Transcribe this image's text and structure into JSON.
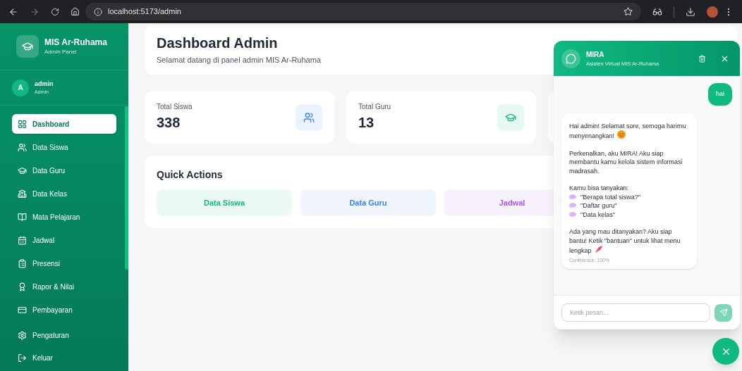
{
  "browser": {
    "url": "localhost:5173/admin"
  },
  "sidebar": {
    "app_name": "MIS Ar-Ruhama",
    "app_subtitle": "Admin Panel",
    "user": {
      "initial": "A",
      "name": "admin",
      "role": "Admin"
    },
    "items": [
      {
        "label": "Dashboard",
        "selected": true
      },
      {
        "label": "Data Siswa",
        "selected": false
      },
      {
        "label": "Data Guru",
        "selected": false
      },
      {
        "label": "Data Kelas",
        "selected": false
      },
      {
        "label": "Mata Pelajaran",
        "selected": false
      },
      {
        "label": "Jadwal",
        "selected": false
      },
      {
        "label": "Presensi",
        "selected": false
      },
      {
        "label": "Rapor & Nilai",
        "selected": false
      },
      {
        "label": "Pembayaran",
        "selected": false
      }
    ],
    "footer_items": [
      {
        "label": "Pengaturan"
      },
      {
        "label": "Keluar"
      }
    ]
  },
  "header": {
    "title": "Dashboard Admin",
    "subtitle": "Selamat datang di panel admin MIS Ar-Ruhama"
  },
  "stats": [
    {
      "label": "Total Siswa",
      "value": "338",
      "color": "#3b82f6"
    },
    {
      "label": "Total Guru",
      "value": "13",
      "color": "#10b981"
    }
  ],
  "quick_actions": {
    "title": "Quick Actions",
    "items": [
      {
        "label": "Data Siswa",
        "color": "#10b981"
      },
      {
        "label": "Data Guru",
        "color": "#3b82f6"
      },
      {
        "label": "Jadwal",
        "color": "#a855f7"
      }
    ]
  },
  "chat": {
    "title": "MIRA",
    "subtitle": "Asisten Virtual MIS Ar-Ruhama",
    "messages": [
      {
        "kind": "user",
        "text": "hai"
      },
      {
        "kind": "bot",
        "blocks": [
          {
            "kind": "greeting",
            "text": "Hai admin! Selamat sore, semoga harimu menyenangkan!"
          },
          {
            "kind": "text",
            "text": "Perkenalkan, aku MIRA! Aku siap membantu kamu kelola sistem informasi madrasah."
          },
          {
            "kind": "list",
            "text": "Kamu bisa tanyakan:",
            "items": [
              "\"Berapa total siswa?\"",
              "\"Daftar guru\"",
              "\"Data kelas\""
            ]
          },
          {
            "kind": "closing",
            "text": "Ada yang mau ditanyakan? Aku siap bantu! Ketik \"bantuan\" untuk lihat menu lengkap"
          }
        ],
        "confidence": "Confidence: 100%"
      }
    ],
    "input": {
      "placeholder": "Ketik pesan..."
    }
  }
}
